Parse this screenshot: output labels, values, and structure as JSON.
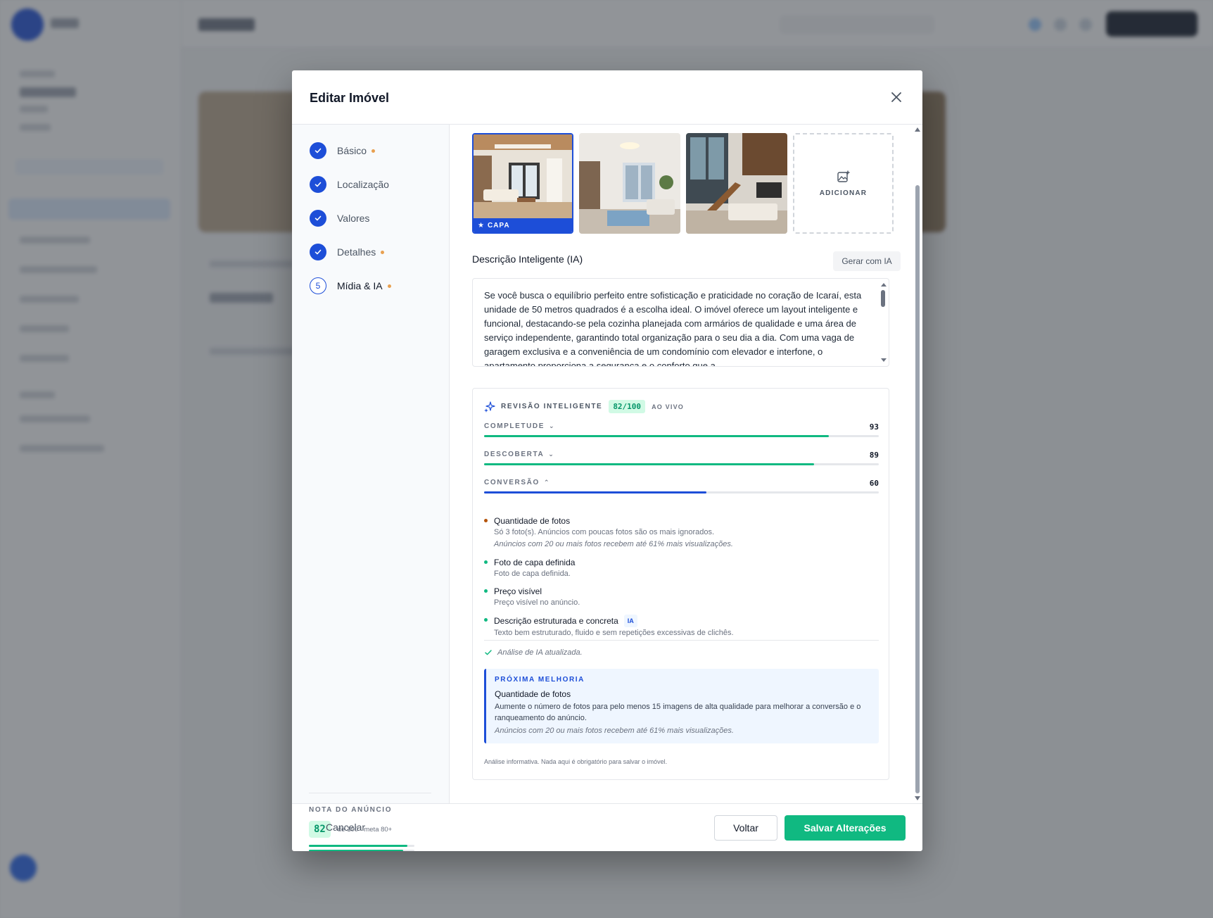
{
  "modal": {
    "title": "Editar Imóvel"
  },
  "steps": [
    {
      "label": "Básico",
      "state": "done",
      "dot": true
    },
    {
      "label": "Localização",
      "state": "done",
      "dot": false
    },
    {
      "label": "Valores",
      "state": "done",
      "dot": false
    },
    {
      "label": "Detalhes",
      "state": "done",
      "dot": true
    },
    {
      "label": "Mídia & IA",
      "state": "current",
      "number": "5",
      "dot": true
    }
  ],
  "listing_score": {
    "title": "NOTA DO ANÚNCIO",
    "value": "82",
    "meta": "de 100 · meta 80+",
    "bars": [
      {
        "fraction": 0.93,
        "color": "#10b981"
      },
      {
        "fraction": 0.89,
        "color": "#10b981"
      },
      {
        "fraction": 0.6,
        "color": "#1d4ed8"
      }
    ]
  },
  "photos": {
    "cover_label": "CAPA",
    "add_label": "ADICIONAR",
    "count": 3
  },
  "description": {
    "title": "Descrição Inteligente (IA)",
    "generate_label": "Gerar com IA",
    "text": "Se você busca o equilíbrio perfeito entre sofisticação e praticidade no coração de Icaraí, esta unidade de 50 metros quadrados é a escolha ideal. O imóvel oferece um layout inteligente e funcional, destacando-se pela cozinha planejada com armários de qualidade e uma área de serviço independente, garantindo total organização para o seu dia a dia. Com uma vaga de garagem exclusiva e a conveniência de um condomínio com elevador e interfone, o apartamento proporciona a segurança e o conforto que a"
  },
  "review": {
    "title": "REVISÃO INTELIGENTE",
    "score": "82/100",
    "live": "AO VIVO",
    "metrics": [
      {
        "label": "COMPLETUDE",
        "value": "93",
        "fraction": 0.93,
        "color": "#10b981",
        "chevron": "⌄"
      },
      {
        "label": "DESCOBERTA",
        "value": "89",
        "fraction": 0.89,
        "color": "#10b981",
        "chevron": "⌄"
      },
      {
        "label": "CONVERSÃO",
        "value": "60",
        "fraction": 0.6,
        "color": "#1d4ed8",
        "chevron": "⌃"
      }
    ],
    "checks": [
      {
        "title": "Quantidade de fotos",
        "desc": "Só 3 foto(s). Anúncios com poucas fotos são os mais ignorados.",
        "hint": "Anúncios com 20 ou mais fotos recebem até 61% mais visualizações.",
        "status": "warning",
        "color": "#b45309"
      },
      {
        "title": "Foto de capa definida",
        "desc": "Foto de capa definida.",
        "hint": "",
        "status": "ok",
        "color": "#10b981"
      },
      {
        "title": "Preço visível",
        "desc": "Preço visível no anúncio.",
        "hint": "",
        "status": "ok",
        "color": "#10b981"
      },
      {
        "title": "Descrição estruturada e concreta",
        "badge": "IA",
        "desc": "Texto bem estruturado, fluido e sem repetições excessivas de clichês.",
        "hint": "",
        "status": "ok",
        "color": "#10b981"
      }
    ],
    "ai_updated": "Análise de IA atualizada.",
    "next": {
      "title": "PRÓXIMA MELHORIA",
      "head": "Quantidade de fotos",
      "desc": "Aumente o número de fotos para pelo menos 15 imagens de alta qualidade para melhorar a conversão e o ranqueamento do anúncio.",
      "hint": "Anúncios com 20 ou mais fotos recebem até 61% mais visualizações."
    },
    "note": "Análise informativa. Nada aqui é obrigatório para salvar o imóvel."
  },
  "footer": {
    "cancel": "Cancelar",
    "back": "Voltar",
    "save": "Salvar Alterações"
  },
  "colors": {
    "primary": "#1d4ed8",
    "success": "#10b981",
    "warning": "#e8a050"
  }
}
